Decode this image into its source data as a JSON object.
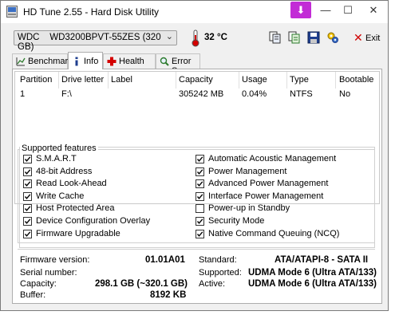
{
  "window": {
    "title": "HD Tune 2.55 - Hard Disk Utility",
    "minimize": "—",
    "maximize": "☐",
    "close": "✕",
    "purple_button": "⬇"
  },
  "toolbar": {
    "drive": "WDC WD3200BPVT-55ZES (320 GB)",
    "drive_vendor": "WDC",
    "drive_model": "WD3200BPVT-55ZES (320 GB)",
    "temperature": "32 °C",
    "exit_label": "Exit"
  },
  "tabs": [
    {
      "label": "Benchmark",
      "icon": "benchmark-icon",
      "active": false
    },
    {
      "label": "Info",
      "icon": "info-icon",
      "active": true
    },
    {
      "label": "Health",
      "icon": "health-icon",
      "active": false
    },
    {
      "label": "Error Scan",
      "icon": "magnifier-icon",
      "active": false
    }
  ],
  "partitions": {
    "columns": [
      "Partition",
      "Drive letter",
      "Label",
      "Capacity",
      "Usage",
      "Type",
      "Bootable"
    ],
    "rows": [
      [
        "1",
        "F:\\",
        "",
        "305242 MB",
        "0.04%",
        "NTFS",
        "No"
      ]
    ]
  },
  "features": {
    "title": "Supported features",
    "left": [
      {
        "label": "S.M.A.R.T",
        "checked": true
      },
      {
        "label": "48-bit Address",
        "checked": true
      },
      {
        "label": "Read Look-Ahead",
        "checked": true
      },
      {
        "label": "Write Cache",
        "checked": true
      },
      {
        "label": "Host Protected Area",
        "checked": true
      },
      {
        "label": "Device Configuration Overlay",
        "checked": true
      },
      {
        "label": "Firmware Upgradable",
        "checked": true
      }
    ],
    "right": [
      {
        "label": "Automatic Acoustic Management",
        "checked": true
      },
      {
        "label": "Power Management",
        "checked": true
      },
      {
        "label": "Advanced Power Management",
        "checked": true
      },
      {
        "label": "Interface Power Management",
        "checked": true
      },
      {
        "label": "Power-up in Standby",
        "checked": false
      },
      {
        "label": "Security Mode",
        "checked": true
      },
      {
        "label": "Native Command Queuing (NCQ)",
        "checked": true
      }
    ]
  },
  "drive_info": {
    "firmware_label": "Firmware version:",
    "firmware_value": "01.01A01",
    "serial_label": "Serial number:",
    "serial_value": "",
    "capacity_label": "Capacity:",
    "capacity_value": "298.1 GB (~320.1 GB)",
    "buffer_label": "Buffer:",
    "buffer_value": "8192 KB",
    "standard_label": "Standard:",
    "standard_value": "ATA/ATAPI-8 - SATA II",
    "supported_label": "Supported:",
    "supported_value": "UDMA Mode 6 (Ultra ATA/133)",
    "active_label": "Active:",
    "active_value": "UDMA Mode 6 (Ultra ATA/133)"
  },
  "colors": {
    "window_bg": "#f0f0f0",
    "exit_x": "#d00000",
    "purple_button": "#c22bd6"
  }
}
